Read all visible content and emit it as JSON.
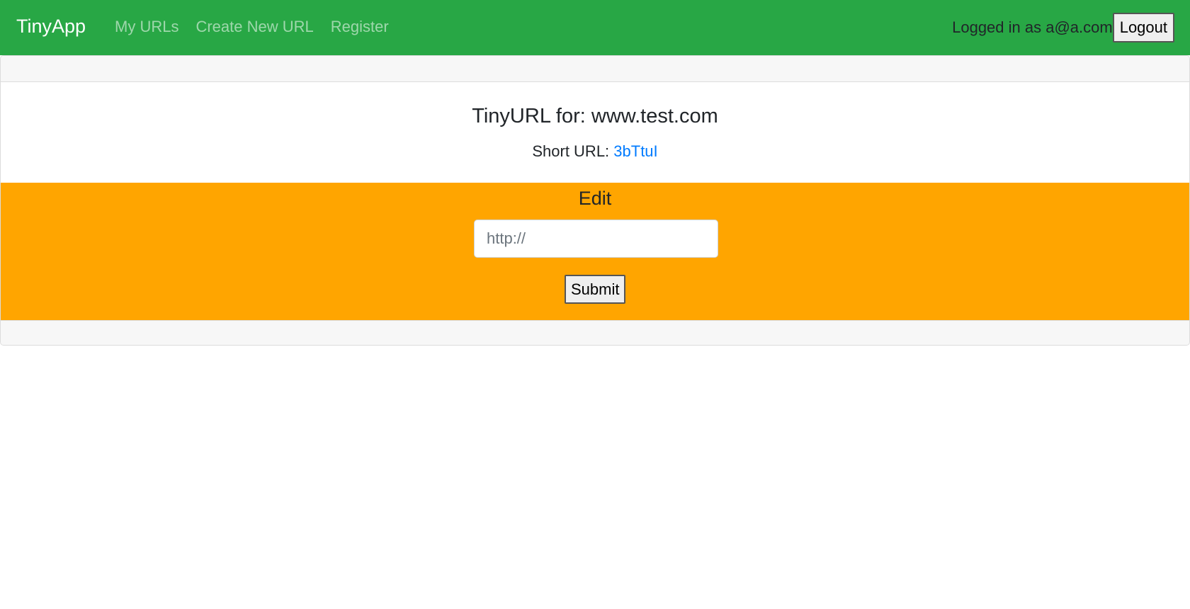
{
  "navbar": {
    "brand": "TinyApp",
    "links": [
      {
        "label": "My URLs"
      },
      {
        "label": "Create New URL"
      },
      {
        "label": "Register"
      }
    ],
    "login_text": "Logged in as a@a.com",
    "logout_label": "Logout"
  },
  "main": {
    "title": "TinyURL for: www.test.com",
    "short_url_label": "Short URL: ",
    "short_url_value": "3bTtuI"
  },
  "edit": {
    "heading": "Edit",
    "input_placeholder": "http://",
    "input_value": "",
    "submit_label": "Submit"
  },
  "colors": {
    "navbar_bg": "#28a745",
    "edit_bg": "#ffa500",
    "link": "#007bff"
  }
}
